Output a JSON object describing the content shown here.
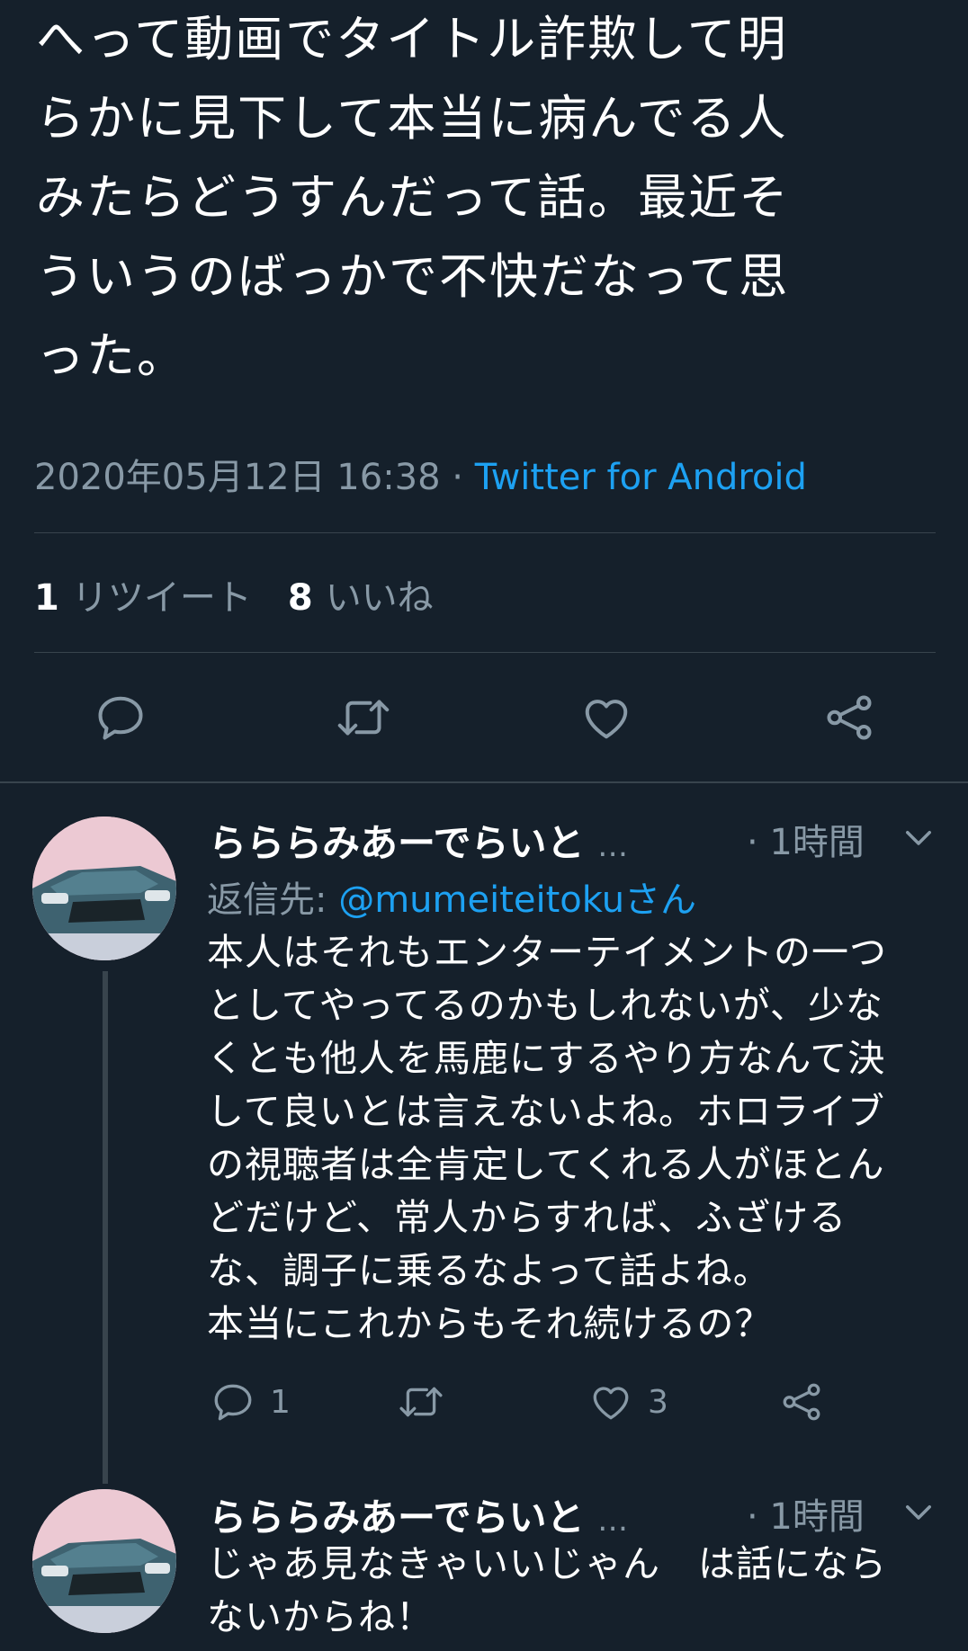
{
  "tweet": {
    "text": "へって動画でタイトル詐欺して明\nらかに見下して本当に病んでる人\nみたらどうすんだって話。最近そ\nういうのばっかで不快だなって思\nった。",
    "datetime": "2020年05月12日 16:38",
    "separator": " · ",
    "source": "Twitter for Android",
    "retweet_count": "1",
    "retweet_label": "リツイート",
    "like_count": "8",
    "like_label": "いいね"
  },
  "actions": {
    "reply_icon": "comment-icon",
    "retweet_icon": "retweet-icon",
    "like_icon": "heart-icon",
    "share_icon": "share-icon"
  },
  "replies": [
    {
      "name": "らららみあーでらいと",
      "ellipsis": "…",
      "time": "· 1時間",
      "replying_prefix": "返信先: ",
      "replying_handle": "@mumeiteitokuさん",
      "text": "本人はそれもエンターテイメントの一つ\nとしてやってるのかもしれないが、少な\nくとも他人を馬鹿にするやり方なんて決\nして良いとは言えないよね。ホロライブ\nの視聴者は全肯定してくれる人がほとん\nどだけど、常人からすれば、ふざける\nな、調子に乗るなよって話よね。\n本当にこれからもそれ続けるの？",
      "reply_count": "1",
      "like_count": "3"
    },
    {
      "name": "らららみあーでらいと",
      "ellipsis": "…",
      "time": "· 1時間",
      "text": "じゃあ見なきゃいいじゃん　は話になら\nないからね！"
    }
  ],
  "colors": {
    "background": "#15202b",
    "secondary_text": "#8899a6",
    "link": "#1da1f2",
    "divider": "#38444d"
  }
}
